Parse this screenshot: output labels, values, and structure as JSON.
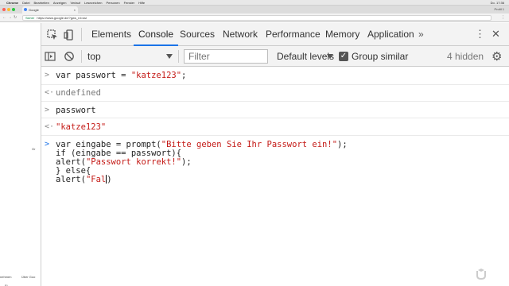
{
  "menubar": {
    "app": "Chrome",
    "items": [
      "Datei",
      "Bearbeiten",
      "Anzeigen",
      "Verlauf",
      "Lesezeichen",
      "Personen",
      "Fenster",
      "Hilfe"
    ],
    "clock": "Do. 17:36"
  },
  "tab": {
    "title": "Google"
  },
  "profile": "Profil 1",
  "address": {
    "secure": "Sicher",
    "url": "https://www.google.de/?gws_rd=ssl"
  },
  "page_fragments": {
    "a": "Gr",
    "b": "nehmen",
    "c": "Über Goo",
    "d": "Ei"
  },
  "devtools": {
    "tabs": [
      "Elements",
      "Console",
      "Sources",
      "Network",
      "Performance",
      "Memory",
      "Application"
    ],
    "more": "»",
    "console_bar": {
      "context": "top",
      "filter_placeholder": "Filter",
      "levels": "Default levels",
      "group_similar": "Group similar",
      "hidden_count": "4 hidden"
    }
  },
  "console": {
    "entries": [
      {
        "kind": "input",
        "prefix": ">",
        "code_pre": "var passwort = ",
        "code_str": "\"katze123\"",
        "code_post": ";"
      },
      {
        "kind": "result",
        "prefix": "<·",
        "value": "undefined"
      },
      {
        "kind": "input",
        "prefix": ">",
        "code_pre": "passwort",
        "code_str": "",
        "code_post": ""
      },
      {
        "kind": "result",
        "prefix": "<·",
        "value": "\"katze123\""
      }
    ],
    "current_input": {
      "prefix": ">",
      "lines": [
        {
          "pre": "var eingabe = prompt(",
          "str": "\"Bitte geben Sie Ihr Passwort ein!\"",
          "post": ");"
        },
        {
          "pre": "if (eingabe == passwort){",
          "str": "",
          "post": ""
        },
        {
          "pre": "alert(",
          "str": "\"Passwort korrekt!\"",
          "post": ");"
        },
        {
          "pre": "} else{",
          "str": "",
          "post": ""
        },
        {
          "pre": "alert(",
          "str": "\"Fal",
          "post": ")"
        }
      ]
    }
  },
  "colors": {
    "string": "#c41a16",
    "active_tab_underline": "#1a73e8"
  }
}
